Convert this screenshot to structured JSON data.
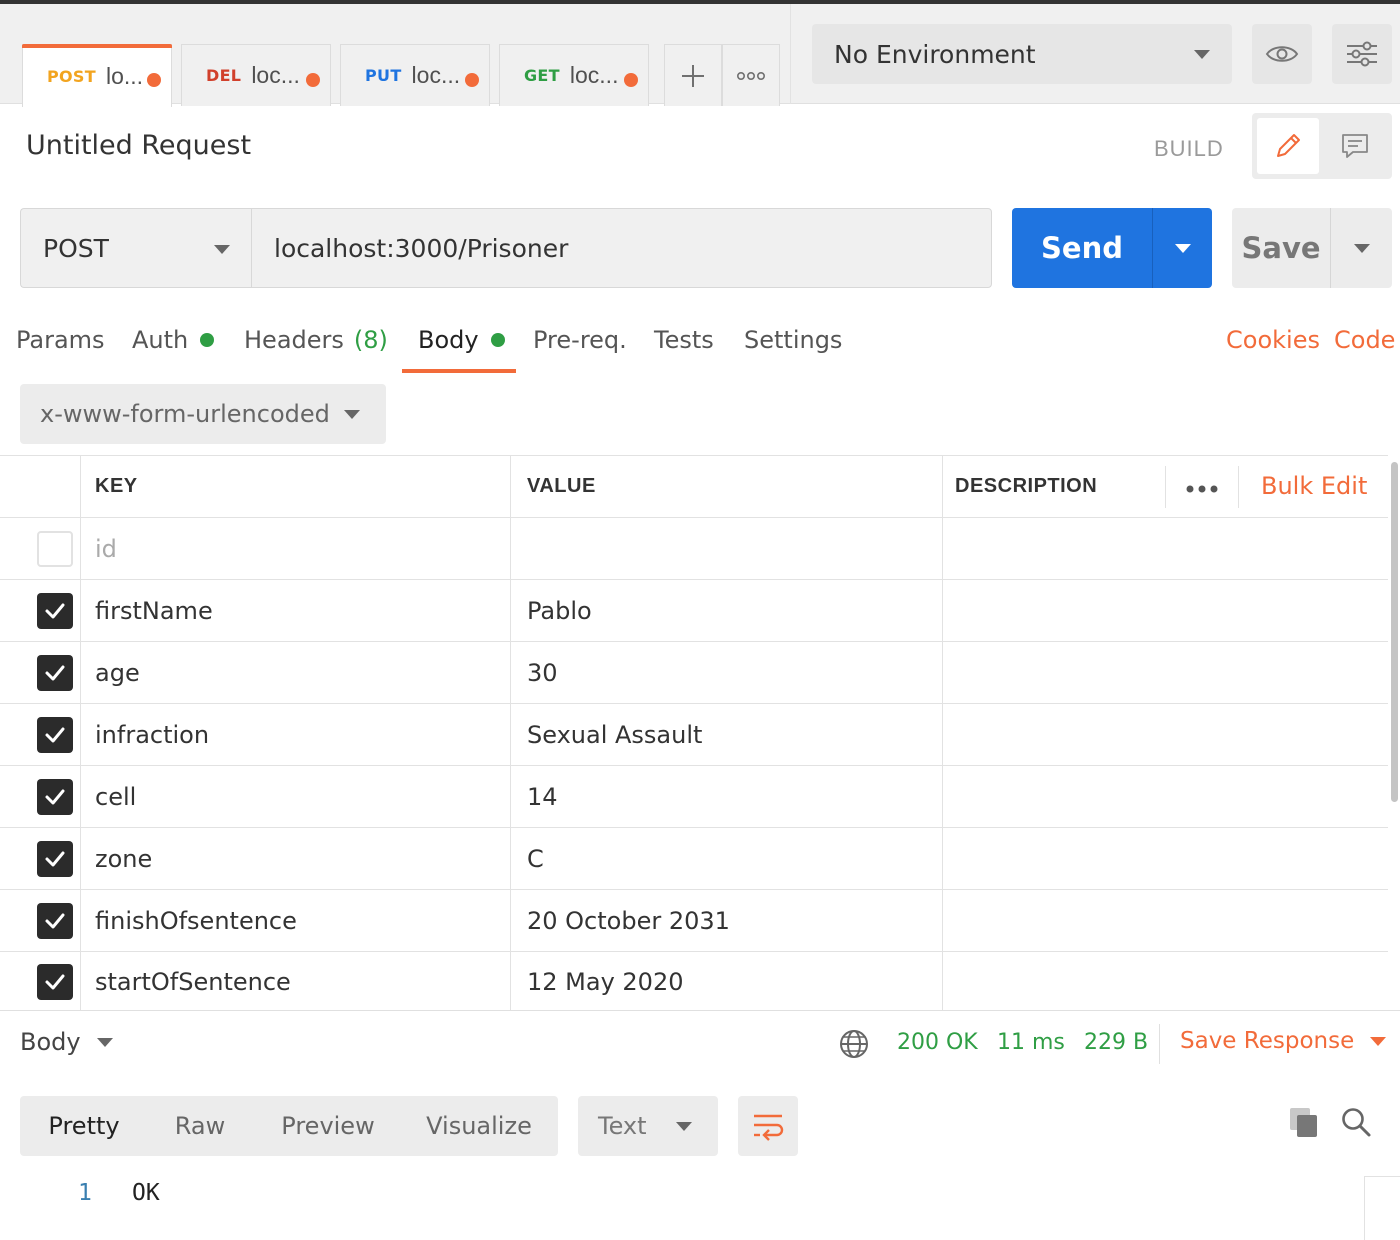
{
  "tabs": [
    {
      "method": "POST",
      "method_color": "#f2a41f",
      "label": "lo...",
      "unsaved": true,
      "active": true
    },
    {
      "method": "DEL",
      "method_color": "#d1402b",
      "label": "loc...",
      "unsaved": true,
      "active": false
    },
    {
      "method": "PUT",
      "method_color": "#1f74e0",
      "label": "loc...",
      "unsaved": true,
      "active": false
    },
    {
      "method": "GET",
      "method_color": "#2f9e44",
      "label": "loc...",
      "unsaved": true,
      "active": false
    }
  ],
  "tab_actions": {
    "new_tab_icon": "plus-icon",
    "more_icon": "ellipsis-icon"
  },
  "environment": {
    "selected": "No Environment",
    "eye_icon": "eye-icon",
    "settings_icon": "sliders-icon"
  },
  "request": {
    "title": "Untitled Request",
    "mode_label": "BUILD",
    "method": "POST",
    "url": "localhost:3000/Prisoner",
    "send_label": "Send",
    "save_label": "Save"
  },
  "request_tabs": {
    "params": "Params",
    "auth": "Auth",
    "headers": "Headers",
    "headers_count": "(8)",
    "body": "Body",
    "prereq": "Pre-req.",
    "tests": "Tests",
    "settings": "Settings",
    "cookies": "Cookies",
    "code": "Code"
  },
  "body_type": "x-www-form-urlencoded",
  "table": {
    "headers": {
      "key": "KEY",
      "value": "VALUE",
      "description": "DESCRIPTION",
      "bulk_edit": "Bulk Edit"
    },
    "placeholder_key": "id",
    "rows": [
      {
        "checked": true,
        "key": "firstName",
        "value": "Pablo"
      },
      {
        "checked": true,
        "key": "age",
        "value": "30"
      },
      {
        "checked": true,
        "key": "infraction",
        "value": "Sexual Assault"
      },
      {
        "checked": true,
        "key": "cell",
        "value": "14"
      },
      {
        "checked": true,
        "key": "zone",
        "value": "C"
      },
      {
        "checked": true,
        "key": "finishOfsentence",
        "value": "20 October 2031"
      },
      {
        "checked": true,
        "key": "startOfSentence",
        "value": "12 May 2020"
      }
    ]
  },
  "response": {
    "section_label": "Body",
    "status": "200 OK",
    "time": "11 ms",
    "size": "229 B",
    "save_response": "Save Response",
    "views": [
      "Pretty",
      "Raw",
      "Preview",
      "Visualize"
    ],
    "active_view": "Pretty",
    "format": "Text",
    "lines": [
      {
        "number": "1",
        "text": "OK"
      }
    ]
  },
  "colors": {
    "accent": "#f26b3a",
    "primary": "#1f74e0",
    "success": "#2f9e44"
  }
}
